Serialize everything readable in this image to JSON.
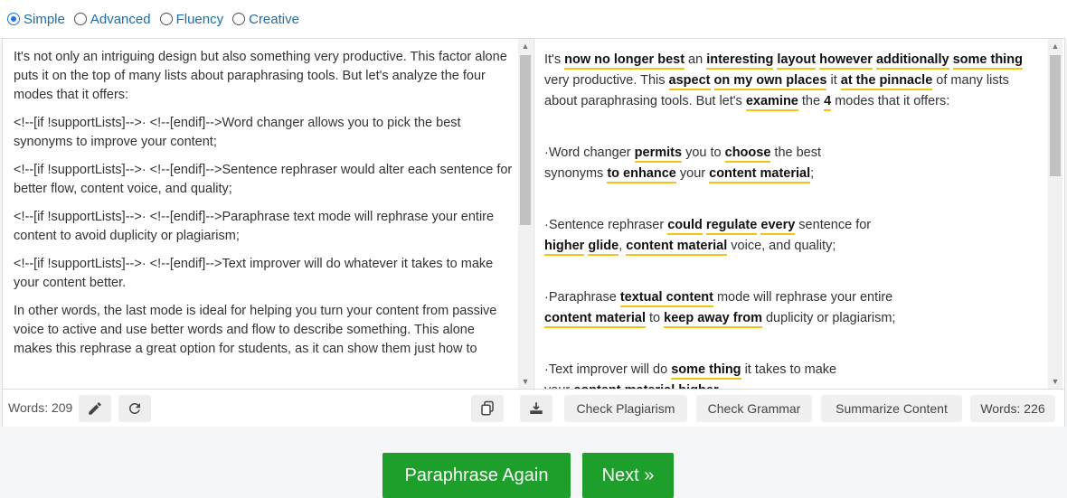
{
  "modes": [
    {
      "label": "Simple",
      "checked": true
    },
    {
      "label": "Advanced",
      "checked": false
    },
    {
      "label": "Fluency",
      "checked": false
    },
    {
      "label": "Creative",
      "checked": false
    }
  ],
  "input": {
    "paragraphs": [
      "It's not only an intriguing design but also something very productive. This factor alone puts it on the top of many lists about paraphrasing tools. But let's analyze the four modes that it offers:",
      "<!--[if !supportLists]-->·        <!--[endif]-->Word changer allows you to pick the best synonyms to improve your content;",
      "<!--[if !supportLists]-->·        <!--[endif]-->Sentence rephraser would alter each sentence for better flow, content voice, and quality;",
      "<!--[if !supportLists]-->·        <!--[endif]-->Paraphrase text mode will rephrase your entire content to avoid duplicity or plagiarism;",
      "<!--[if !supportLists]-->·        <!--[endif]-->Text improver will do whatever it takes to make your content better.",
      "In other words, the last mode is ideal for helping you turn your content from passive voice to active and use better words and flow to describe something. This alone makes this rephrase a great option for students, as it can show them just how to"
    ],
    "word_count": "Words: 209"
  },
  "output": {
    "paragraphs": [
      [
        {
          "t": "It's ",
          "h": false
        },
        {
          "t": "now no longer best",
          "h": true
        },
        {
          "t": " an ",
          "h": false
        },
        {
          "t": "interesting",
          "h": true
        },
        {
          "t": " ",
          "h": false
        },
        {
          "t": "layout",
          "h": true
        },
        {
          "t": " ",
          "h": false
        },
        {
          "t": "however",
          "h": true
        },
        {
          "t": " ",
          "h": false
        },
        {
          "t": "additionally",
          "h": true
        },
        {
          "t": " ",
          "h": false
        },
        {
          "t": "some thing",
          "h": true
        },
        {
          "t": " very productive. This ",
          "h": false
        },
        {
          "t": "aspect",
          "h": true
        },
        {
          "t": " ",
          "h": false
        },
        {
          "t": "on my own places",
          "h": true
        },
        {
          "t": " it ",
          "h": false
        },
        {
          "t": "at the pinnacle",
          "h": true
        },
        {
          "t": " of many lists about paraphrasing tools. But let's ",
          "h": false
        },
        {
          "t": "examine",
          "h": true
        },
        {
          "t": " the ",
          "h": false
        },
        {
          "t": "4",
          "h": true
        },
        {
          "t": " modes that it offers:",
          "h": false
        }
      ],
      [
        {
          "t": "·Word changer ",
          "h": false
        },
        {
          "t": "permits",
          "h": true
        },
        {
          "t": " you to ",
          "h": false
        },
        {
          "t": "choose",
          "h": true
        },
        {
          "t": " the best",
          "h": false
        },
        {
          "t": "\n",
          "h": false
        },
        {
          "t": "synonyms ",
          "h": false
        },
        {
          "t": "to enhance",
          "h": true
        },
        {
          "t": " your ",
          "h": false
        },
        {
          "t": "content material",
          "h": true
        },
        {
          "t": ";",
          "h": false
        }
      ],
      [
        {
          "t": "·Sentence rephraser ",
          "h": false
        },
        {
          "t": "could",
          "h": true
        },
        {
          "t": " ",
          "h": false
        },
        {
          "t": "regulate",
          "h": true
        },
        {
          "t": " ",
          "h": false
        },
        {
          "t": "every",
          "h": true
        },
        {
          "t": " sentence for",
          "h": false
        },
        {
          "t": "\n",
          "h": false
        },
        {
          "t": "higher",
          "h": true
        },
        {
          "t": " ",
          "h": false
        },
        {
          "t": "glide",
          "h": true
        },
        {
          "t": ", ",
          "h": false
        },
        {
          "t": "content material",
          "h": true
        },
        {
          "t": " voice, and quality;",
          "h": false
        }
      ],
      [
        {
          "t": "·Paraphrase ",
          "h": false
        },
        {
          "t": "textual content",
          "h": true
        },
        {
          "t": " mode will rephrase your entire",
          "h": false
        },
        {
          "t": "\n",
          "h": false
        },
        {
          "t": "content material",
          "h": true
        },
        {
          "t": " to ",
          "h": false
        },
        {
          "t": "keep away from",
          "h": true
        },
        {
          "t": " duplicity or plagiarism;",
          "h": false
        }
      ],
      [
        {
          "t": "·Text improver will do ",
          "h": false
        },
        {
          "t": "some thing",
          "h": true
        },
        {
          "t": " it takes to make",
          "h": false
        },
        {
          "t": "\n",
          "h": false
        },
        {
          "t": "your ",
          "h": false
        },
        {
          "t": "content material",
          "h": true
        },
        {
          "t": " ",
          "h": false
        },
        {
          "t": "higher",
          "h": true
        },
        {
          "t": ".",
          "h": false
        }
      ]
    ],
    "word_count": "Words: 226"
  },
  "toolbar": {
    "edit_icon": "pencil-icon",
    "refresh_icon": "refresh-icon",
    "copy_icon": "copy-icon",
    "download_icon": "download-icon",
    "check_plagiarism": "Check Plagiarism",
    "check_grammar": "Check Grammar",
    "summarize": "Summarize Content"
  },
  "actions": {
    "paraphrase_again": "Paraphrase Again",
    "next": "Next »"
  },
  "colors": {
    "accent": "#1a73e8",
    "highlight": "#f3c513",
    "green": "#1e9e2a"
  }
}
